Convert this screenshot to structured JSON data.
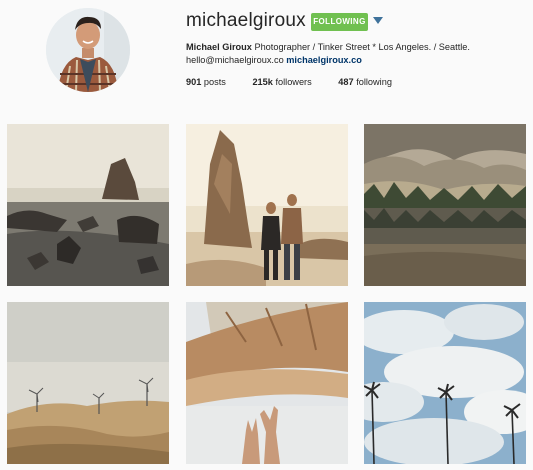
{
  "profile": {
    "username": "michaelgiroux",
    "follow_button": "FOLLOWING",
    "full_name": "Michael Giroux",
    "bio": "Photographer / Tinker Street * Los Angeles. / Seattle.",
    "email": "hello@michaelgiroux.co",
    "website": "michaelgiroux.co"
  },
  "stats": [
    {
      "value": "901",
      "label": "posts"
    },
    {
      "value": "215k",
      "label": "followers"
    },
    {
      "value": "487",
      "label": "following"
    }
  ],
  "colors": {
    "following_green": "#70c050",
    "link_blue": "#003569",
    "caret_blue": "#3f729b",
    "background": "#fafafa"
  },
  "icons": {
    "caret": "chevron-down-icon"
  }
}
